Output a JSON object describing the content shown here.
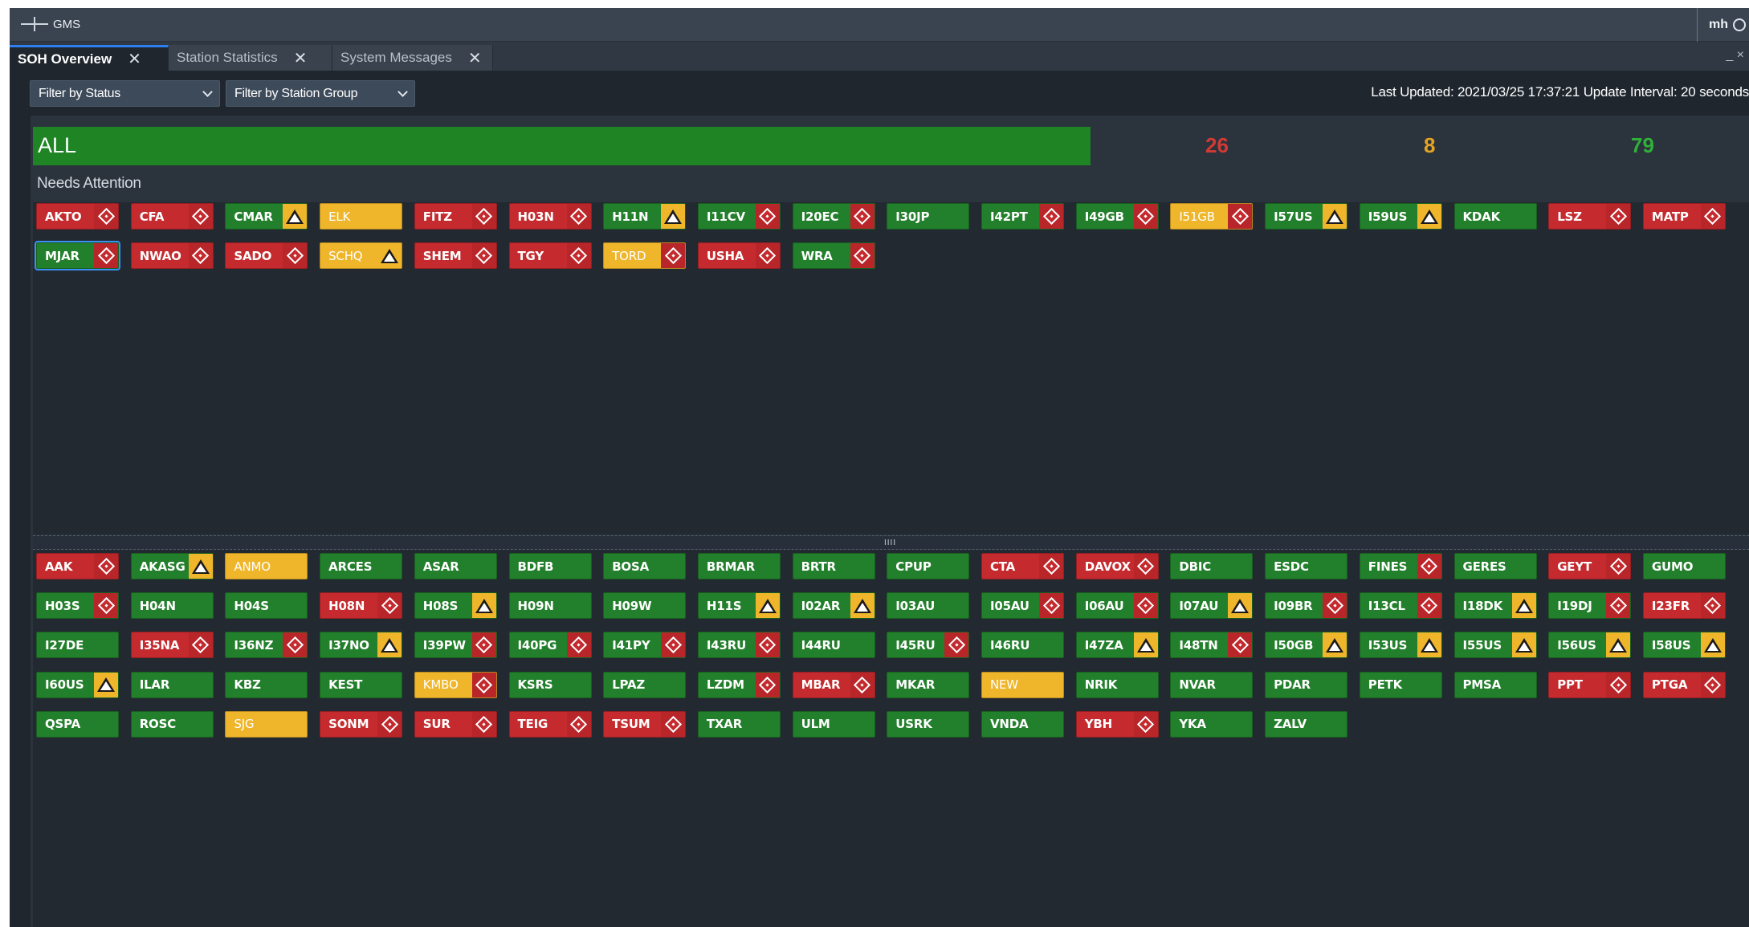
{
  "app": {
    "title": "GMS",
    "user": "mh"
  },
  "tabs": [
    {
      "label": "SOH Overview",
      "active": true
    },
    {
      "label": "Station Statistics",
      "active": false
    },
    {
      "label": "System Messages",
      "active": false
    }
  ],
  "window_controls": "_ ×",
  "filters": {
    "status": "Filter by Status",
    "station_group": "Filter by Station Group"
  },
  "status_line": "Last Updated: 2021/03/25 17:37:21  Update Interval: 20 seconds",
  "summary": {
    "group": "ALL",
    "counts": [
      {
        "value": "26",
        "color": "#d23a34"
      },
      {
        "value": "8",
        "color": "#e7a420"
      },
      {
        "value": "79",
        "color": "#2fb03a"
      }
    ]
  },
  "needs_attention": {
    "title": "Needs Attention",
    "stations": [
      {
        "name": "AKTO",
        "status": "red",
        "icon": "diamond"
      },
      {
        "name": "CFA",
        "status": "red",
        "icon": "diamond"
      },
      {
        "name": "CMAR",
        "status": "green",
        "icon": "triangle"
      },
      {
        "name": "ELK",
        "status": "yellow",
        "icon": ""
      },
      {
        "name": "FITZ",
        "status": "red",
        "icon": "diamond"
      },
      {
        "name": "H03N",
        "status": "red",
        "icon": "diamond"
      },
      {
        "name": "H11N",
        "status": "green",
        "icon": "triangle"
      },
      {
        "name": "I11CV",
        "status": "green",
        "icon": "diamond"
      },
      {
        "name": "I20EC",
        "status": "green",
        "icon": "diamond"
      },
      {
        "name": "I30JP",
        "status": "green",
        "icon": ""
      },
      {
        "name": "I42PT",
        "status": "green",
        "icon": "diamond"
      },
      {
        "name": "I49GB",
        "status": "green",
        "icon": "diamond"
      },
      {
        "name": "I51GB",
        "status": "yellow",
        "icon": "diamond"
      },
      {
        "name": "I57US",
        "status": "green",
        "icon": "triangle"
      },
      {
        "name": "I59US",
        "status": "green",
        "icon": "triangle"
      },
      {
        "name": "KDAK",
        "status": "green",
        "icon": ""
      },
      {
        "name": "LSZ",
        "status": "red",
        "icon": "diamond"
      },
      {
        "name": "MATP",
        "status": "red",
        "icon": "diamond"
      },
      {
        "name": "MJAR",
        "status": "green",
        "icon": "diamond",
        "selected": true
      },
      {
        "name": "NWAO",
        "status": "red",
        "icon": "diamond"
      },
      {
        "name": "SADO",
        "status": "red",
        "icon": "diamond"
      },
      {
        "name": "SCHQ",
        "status": "yellow",
        "icon": "triangle"
      },
      {
        "name": "SHEM",
        "status": "red",
        "icon": "diamond"
      },
      {
        "name": "TGY",
        "status": "red",
        "icon": "diamond"
      },
      {
        "name": "TORD",
        "status": "yellow",
        "icon": "diamond"
      },
      {
        "name": "USHA",
        "status": "red",
        "icon": "diamond"
      },
      {
        "name": "WRA",
        "status": "green",
        "icon": "diamond"
      }
    ]
  },
  "divider_grip": "IIII",
  "all_stations": [
    {
      "name": "AAK",
      "status": "red",
      "icon": "diamond"
    },
    {
      "name": "AKASG",
      "status": "green",
      "icon": "triangle"
    },
    {
      "name": "ANMO",
      "status": "yellow",
      "icon": ""
    },
    {
      "name": "ARCES",
      "status": "green",
      "icon": ""
    },
    {
      "name": "ASAR",
      "status": "green",
      "icon": ""
    },
    {
      "name": "BDFB",
      "status": "green",
      "icon": ""
    },
    {
      "name": "BOSA",
      "status": "green",
      "icon": ""
    },
    {
      "name": "BRMAR",
      "status": "green",
      "icon": ""
    },
    {
      "name": "BRTR",
      "status": "green",
      "icon": ""
    },
    {
      "name": "CPUP",
      "status": "green",
      "icon": ""
    },
    {
      "name": "CTA",
      "status": "red",
      "icon": "diamond"
    },
    {
      "name": "DAVOX",
      "status": "red",
      "icon": "diamond"
    },
    {
      "name": "DBIC",
      "status": "green",
      "icon": ""
    },
    {
      "name": "ESDC",
      "status": "green",
      "icon": ""
    },
    {
      "name": "FINES",
      "status": "green",
      "icon": "diamond"
    },
    {
      "name": "GERES",
      "status": "green",
      "icon": ""
    },
    {
      "name": "GEYT",
      "status": "red",
      "icon": "diamond"
    },
    {
      "name": "GUMO",
      "status": "green",
      "icon": ""
    },
    {
      "name": "H03S",
      "status": "green",
      "icon": "diamond"
    },
    {
      "name": "H04N",
      "status": "green",
      "icon": ""
    },
    {
      "name": "H04S",
      "status": "green",
      "icon": ""
    },
    {
      "name": "H08N",
      "status": "red",
      "icon": "diamond"
    },
    {
      "name": "H08S",
      "status": "green",
      "icon": "triangle"
    },
    {
      "name": "H09N",
      "status": "green",
      "icon": ""
    },
    {
      "name": "H09W",
      "status": "green",
      "icon": ""
    },
    {
      "name": "H11S",
      "status": "green",
      "icon": "triangle"
    },
    {
      "name": "I02AR",
      "status": "green",
      "icon": "triangle"
    },
    {
      "name": "I03AU",
      "status": "green",
      "icon": ""
    },
    {
      "name": "I05AU",
      "status": "green",
      "icon": "diamond"
    },
    {
      "name": "I06AU",
      "status": "green",
      "icon": "diamond"
    },
    {
      "name": "I07AU",
      "status": "green",
      "icon": "triangle"
    },
    {
      "name": "I09BR",
      "status": "green",
      "icon": "diamond"
    },
    {
      "name": "I13CL",
      "status": "green",
      "icon": "diamond"
    },
    {
      "name": "I18DK",
      "status": "green",
      "icon": "triangle"
    },
    {
      "name": "I19DJ",
      "status": "green",
      "icon": "diamond"
    },
    {
      "name": "I23FR",
      "status": "red",
      "icon": "diamond"
    },
    {
      "name": "I27DE",
      "status": "green",
      "icon": ""
    },
    {
      "name": "I35NA",
      "status": "red",
      "icon": "diamond"
    },
    {
      "name": "I36NZ",
      "status": "green",
      "icon": "diamond"
    },
    {
      "name": "I37NO",
      "status": "green",
      "icon": "triangle"
    },
    {
      "name": "I39PW",
      "status": "green",
      "icon": "diamond"
    },
    {
      "name": "I40PG",
      "status": "green",
      "icon": "diamond"
    },
    {
      "name": "I41PY",
      "status": "green",
      "icon": "diamond"
    },
    {
      "name": "I43RU",
      "status": "green",
      "icon": "diamond"
    },
    {
      "name": "I44RU",
      "status": "green",
      "icon": ""
    },
    {
      "name": "I45RU",
      "status": "green",
      "icon": "diamond"
    },
    {
      "name": "I46RU",
      "status": "green",
      "icon": ""
    },
    {
      "name": "I47ZA",
      "status": "green",
      "icon": "triangle"
    },
    {
      "name": "I48TN",
      "status": "green",
      "icon": "diamond"
    },
    {
      "name": "I50GB",
      "status": "green",
      "icon": "triangle"
    },
    {
      "name": "I53US",
      "status": "green",
      "icon": "triangle"
    },
    {
      "name": "I55US",
      "status": "green",
      "icon": "triangle"
    },
    {
      "name": "I56US",
      "status": "green",
      "icon": "triangle"
    },
    {
      "name": "I58US",
      "status": "green",
      "icon": "triangle"
    },
    {
      "name": "I60US",
      "status": "green",
      "icon": "triangle"
    },
    {
      "name": "ILAR",
      "status": "green",
      "icon": ""
    },
    {
      "name": "KBZ",
      "status": "green",
      "icon": ""
    },
    {
      "name": "KEST",
      "status": "green",
      "icon": ""
    },
    {
      "name": "KMBO",
      "status": "yellow",
      "icon": "diamond"
    },
    {
      "name": "KSRS",
      "status": "green",
      "icon": ""
    },
    {
      "name": "LPAZ",
      "status": "green",
      "icon": ""
    },
    {
      "name": "LZDM",
      "status": "green",
      "icon": "diamond"
    },
    {
      "name": "MBAR",
      "status": "red",
      "icon": "diamond"
    },
    {
      "name": "MKAR",
      "status": "green",
      "icon": ""
    },
    {
      "name": "NEW",
      "status": "yellow",
      "icon": ""
    },
    {
      "name": "NRIK",
      "status": "green",
      "icon": ""
    },
    {
      "name": "NVAR",
      "status": "green",
      "icon": ""
    },
    {
      "name": "PDAR",
      "status": "green",
      "icon": ""
    },
    {
      "name": "PETK",
      "status": "green",
      "icon": ""
    },
    {
      "name": "PMSA",
      "status": "green",
      "icon": ""
    },
    {
      "name": "PPT",
      "status": "red",
      "icon": "diamond"
    },
    {
      "name": "PTGA",
      "status": "red",
      "icon": "diamond"
    },
    {
      "name": "QSPA",
      "status": "green",
      "icon": ""
    },
    {
      "name": "ROSC",
      "status": "green",
      "icon": ""
    },
    {
      "name": "SJG",
      "status": "yellow",
      "icon": ""
    },
    {
      "name": "SONM",
      "status": "red",
      "icon": "diamond"
    },
    {
      "name": "SUR",
      "status": "red",
      "icon": "diamond"
    },
    {
      "name": "TEIG",
      "status": "red",
      "icon": "diamond"
    },
    {
      "name": "TSUM",
      "status": "red",
      "icon": "diamond"
    },
    {
      "name": "TXAR",
      "status": "green",
      "icon": ""
    },
    {
      "name": "ULM",
      "status": "green",
      "icon": ""
    },
    {
      "name": "USRK",
      "status": "green",
      "icon": ""
    },
    {
      "name": "VNDA",
      "status": "green",
      "icon": ""
    },
    {
      "name": "YBH",
      "status": "red",
      "icon": "diamond"
    },
    {
      "name": "YKA",
      "status": "green",
      "icon": ""
    },
    {
      "name": "ZALV",
      "status": "green",
      "icon": ""
    }
  ]
}
